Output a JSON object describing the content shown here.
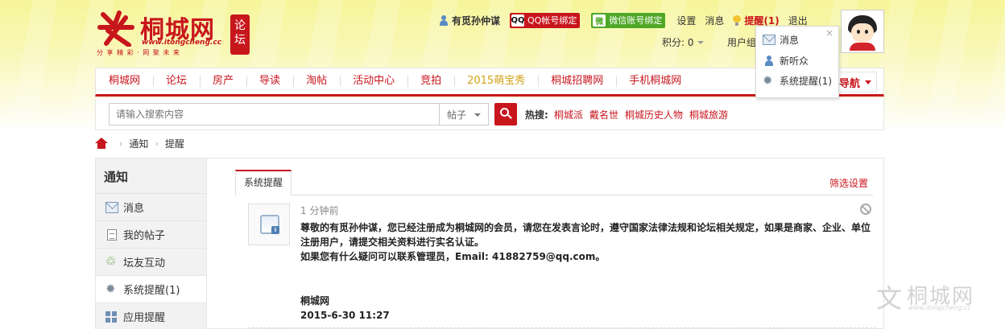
{
  "logo": {
    "mark_glyph": "文",
    "name": "桐城网",
    "domain": "www.itongcheng.cc",
    "forum_tag": "论坛",
    "slogan": "分 享 精 彩 · 网 聚 未 来"
  },
  "userbar": {
    "username": "有觅孙仲谋",
    "qq_bind": "QQ帐号绑定",
    "qq_icon_text": "QQ",
    "wechat_bind": "微信账号绑定",
    "wechat_icon_text": "微",
    "settings": "设置",
    "messages": "消息",
    "reminders": "提醒(1)",
    "logout": "退出",
    "points": "积分: 0",
    "user_group": "用户组"
  },
  "dropdown": {
    "close": "×",
    "items": [
      "消息",
      "新听众",
      "系统提醒(1)"
    ]
  },
  "nav": {
    "items": [
      "桐城网",
      "论坛",
      "房产",
      "导读",
      "淘帖",
      "活动中心",
      "竞拍",
      "2015萌宝秀",
      "桐城招聘网",
      "手机桐城网"
    ],
    "more": "导航"
  },
  "search": {
    "placeholder": "请输入搜索内容",
    "type": "帖子",
    "hot_label": "热搜:",
    "hot": [
      "桐城派",
      "戴名世",
      "桐城历史人物",
      "桐城旅游"
    ]
  },
  "breadcrumb": {
    "sep": "›",
    "items": [
      "通知",
      "提醒"
    ]
  },
  "sidebar": {
    "title": "通知",
    "items": [
      "消息",
      "我的帖子",
      "坛友互动",
      "系统提醒(1)",
      "应用提醒"
    ]
  },
  "content": {
    "tab": "系统提醒",
    "filter": "筛选设置",
    "notice": {
      "time": "1 分钟前",
      "icon_badge": "i",
      "line1": "尊敬的有觅孙仲谋，您已经注册成为桐城网的会员，请您在发表言论时，遵守国家法律法规和论坛相关规定，如果是商家、企业、单位",
      "line2": "注册用户，请提交相关资料进行实名认证。",
      "line3": "如果您有什么疑问可以联系管理员，Email: 41882759@qq.com。",
      "sign_name": "桐城网",
      "sign_date": "2015-6-30 11:27"
    }
  },
  "watermark": {
    "mark": "文",
    "name": "桐城网",
    "domain": "www.itongcheng.cc"
  },
  "colors": {
    "brand_red": "#c8161d",
    "wechat_green": "#4ea826",
    "gold": "#d4a114"
  }
}
